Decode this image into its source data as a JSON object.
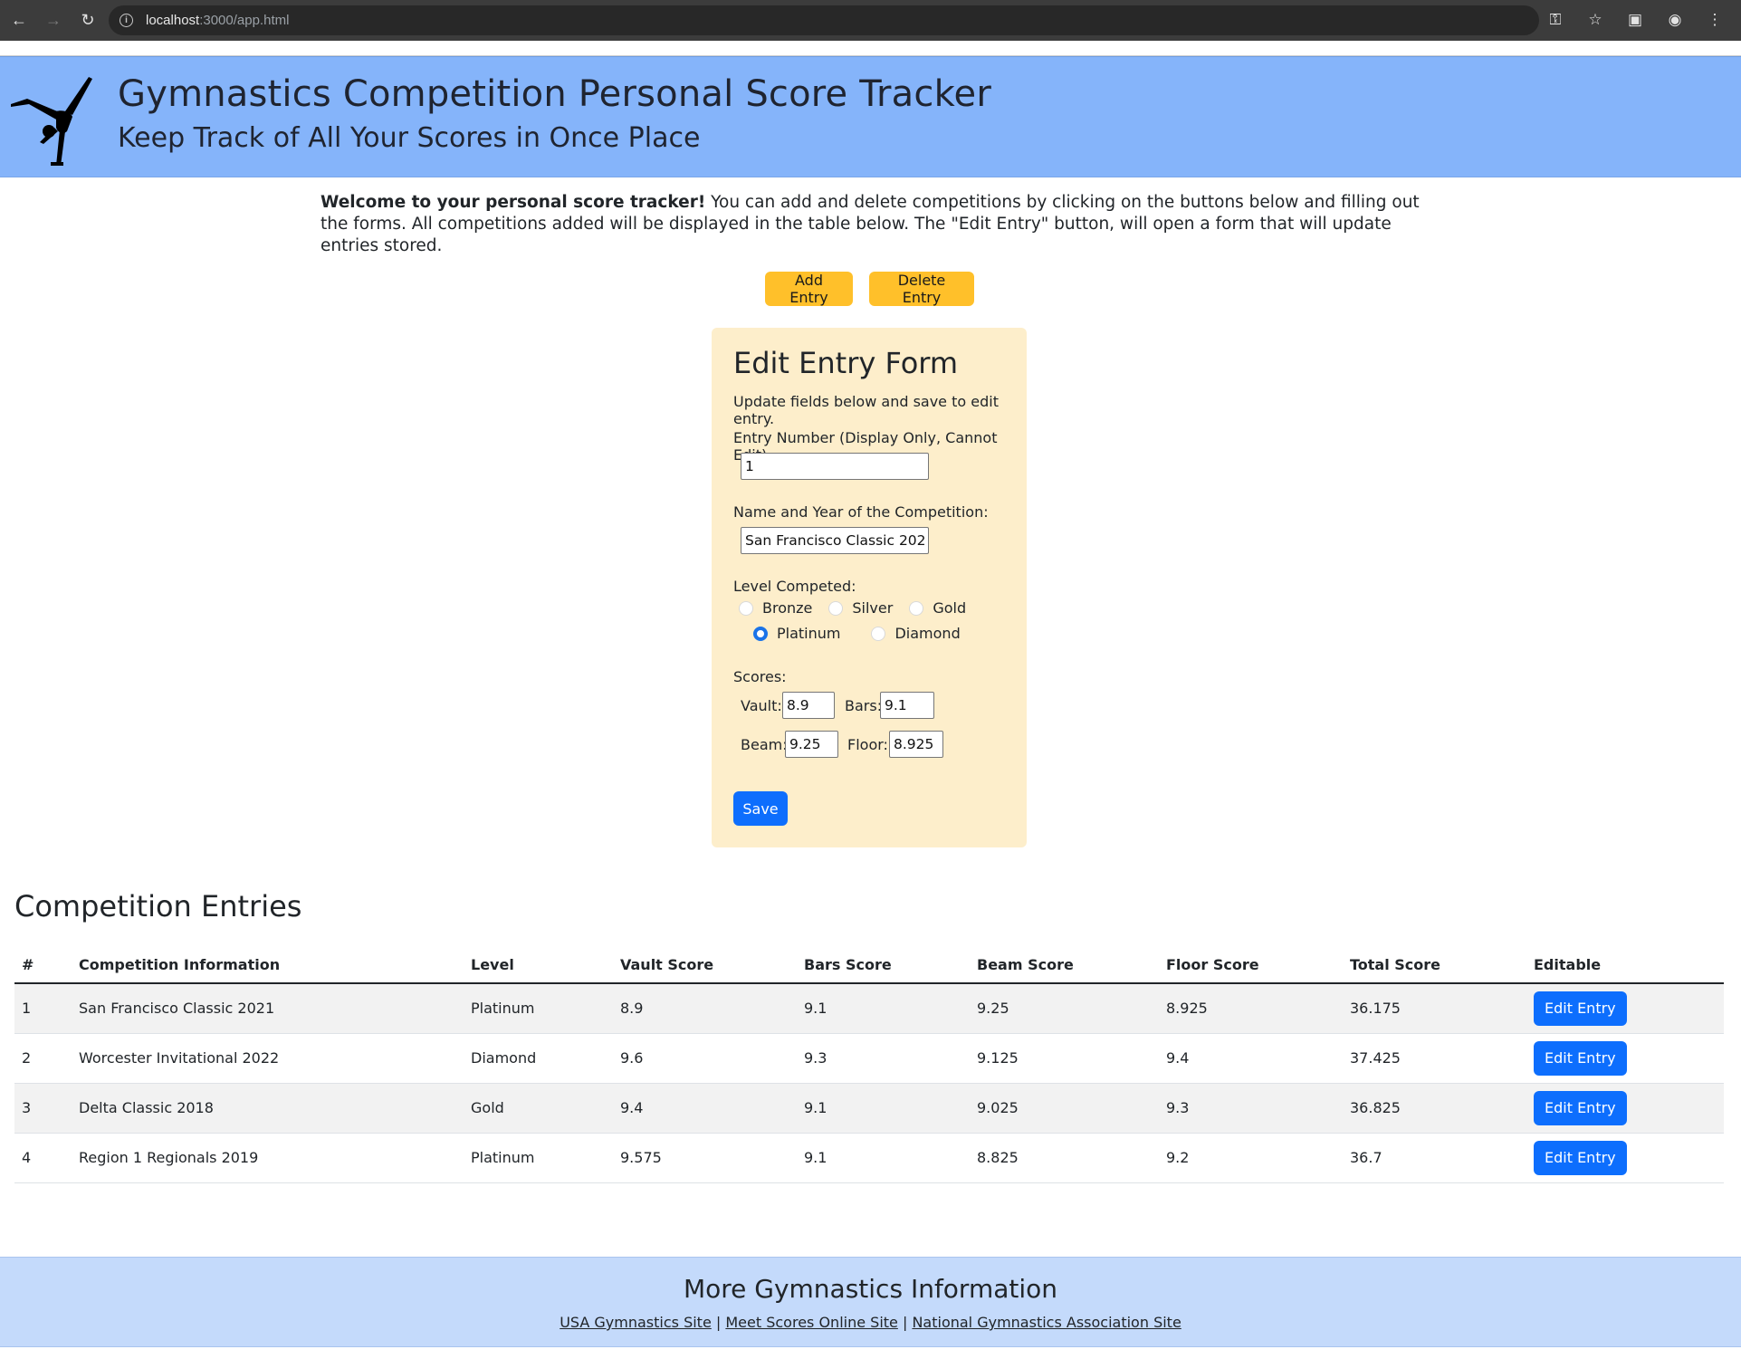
{
  "browser": {
    "url_host": "localhost",
    "url_path": ":3000/app.html"
  },
  "header": {
    "title": "Gymnastics Competition Personal Score Tracker",
    "subtitle": "Keep Track of All Your Scores in Once Place"
  },
  "intro": {
    "bold": "Welcome to your personal score tracker!",
    "text": " You can add and delete competitions by clicking on the buttons below and filling out the forms. All competitions added will be displayed in the table below. The \"Edit Entry\" button, will open a form that will update entries stored."
  },
  "actions": {
    "add_label": "Add Entry",
    "delete_label": "Delete Entry"
  },
  "form": {
    "title": "Edit Entry Form",
    "description": "Update fields below and save to edit entry.",
    "entry_number_label": "Entry Number (Display Only, Cannot Edit)",
    "entry_number_value": "1",
    "name_label": "Name and Year of the Competition:",
    "name_value": "San Francisco Classic 2021",
    "level_label": "Level Competed:",
    "levels": [
      "Bronze",
      "Silver",
      "Gold",
      "Platinum",
      "Diamond"
    ],
    "selected_level": "Platinum",
    "scores_label": "Scores:",
    "vault_label": "Vault:",
    "vault_value": "8.9",
    "bars_label": "Bars:",
    "bars_value": "9.1",
    "beam_label": "Beam:",
    "beam_value": "9.25",
    "floor_label": "Floor:",
    "floor_value": "8.925",
    "save_label": "Save"
  },
  "table": {
    "title": "Competition Entries",
    "headers": [
      "#",
      "Competition Information",
      "Level",
      "Vault Score",
      "Bars Score",
      "Beam Score",
      "Floor Score",
      "Total Score",
      "Editable"
    ],
    "edit_label": "Edit Entry",
    "rows": [
      {
        "num": "1",
        "name": "San Francisco Classic 2021",
        "level": "Platinum",
        "vault": "8.9",
        "bars": "9.1",
        "beam": "9.25",
        "floor": "8.925",
        "total": "36.175"
      },
      {
        "num": "2",
        "name": "Worcester Invitational 2022",
        "level": "Diamond",
        "vault": "9.6",
        "bars": "9.3",
        "beam": "9.125",
        "floor": "9.4",
        "total": "37.425"
      },
      {
        "num": "3",
        "name": "Delta Classic 2018",
        "level": "Gold",
        "vault": "9.4",
        "bars": "9.1",
        "beam": "9.025",
        "floor": "9.3",
        "total": "36.825"
      },
      {
        "num": "4",
        "name": "Region 1 Regionals 2019",
        "level": "Platinum",
        "vault": "9.575",
        "bars": "9.1",
        "beam": "8.825",
        "floor": "9.2",
        "total": "36.7"
      }
    ]
  },
  "footer": {
    "title": "More Gymnastics Information",
    "links": [
      "USA Gymnastics Site",
      "Meet Scores Online Site",
      "National Gymnastics Association Site"
    ],
    "separator": "|"
  },
  "colors": {
    "header_bg": "#85b4fa",
    "form_bg": "#fdeecb",
    "warning": "#ffc02a",
    "primary": "#0d6efd",
    "footer_bg": "#c4dafb"
  },
  "icons": {
    "back": "arrow-left-icon",
    "forward": "arrow-right-icon",
    "reload": "reload-icon",
    "site_info": "info-icon",
    "password": "key-icon",
    "bookmark": "star-icon",
    "tab_search": "tab-search-icon",
    "profile": "profile-icon",
    "menu": "kebab-menu-icon",
    "logo": "gymnast-silhouette-icon"
  }
}
